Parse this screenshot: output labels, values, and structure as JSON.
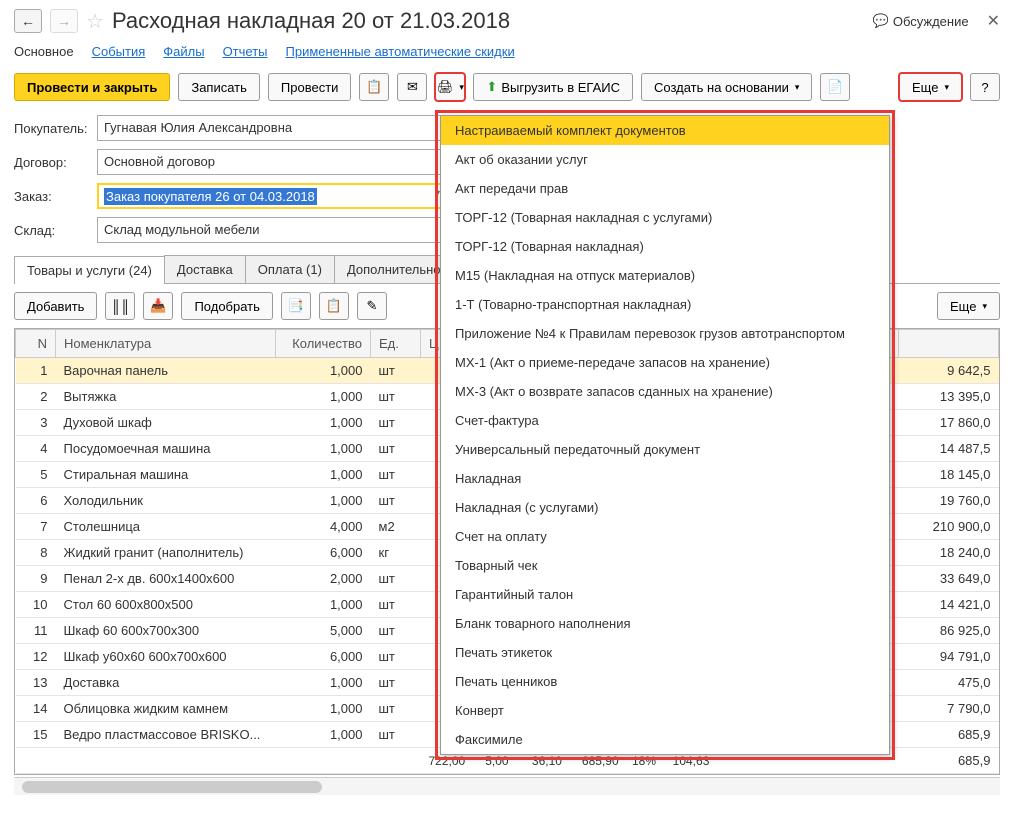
{
  "title": "Расходная накладная 20 от 21.03.2018",
  "topbar": {
    "discussion": "Обсуждение"
  },
  "navTabs": [
    "Основное",
    "События",
    "Файлы",
    "Отчеты",
    "Примененные автоматические скидки"
  ],
  "toolbar": {
    "primary": "Провести и закрыть",
    "save": "Записать",
    "post": "Провести",
    "upload": "Выгрузить в ЕГАИС",
    "createBased": "Создать на основании",
    "more": "Еще",
    "help": "?"
  },
  "form": {
    "buyerLabel": "Покупатель:",
    "buyer": "Гугнавая Юлия Александровна",
    "contractLabel": "Договор:",
    "contract": "Основной договор",
    "orderLabel": "Заказ:",
    "order": "Заказ покупателя 26 от 04.03.2018",
    "warehouseLabel": "Склад:",
    "warehouse": "Склад модульной мебели"
  },
  "subTabs": [
    "Товары и услуги (24)",
    "Доставка",
    "Оплата (1)",
    "Дополнительно"
  ],
  "tableToolbar": {
    "add": "Добавить",
    "pick": "Подобрать",
    "more": "Еще"
  },
  "columns": {
    "n": "N",
    "name": "Номенклатура",
    "qty": "Количество",
    "unit": "Ед.",
    "price": "Ц",
    "sum": ""
  },
  "rows": [
    {
      "n": 1,
      "name": "Варочная панель",
      "qty": "1,000",
      "unit": "шт",
      "sum": "9 642,5"
    },
    {
      "n": 2,
      "name": "Вытяжка",
      "qty": "1,000",
      "unit": "шт",
      "sum": "13 395,0"
    },
    {
      "n": 3,
      "name": "Духовой шкаф",
      "qty": "1,000",
      "unit": "шт",
      "sum": "17 860,0"
    },
    {
      "n": 4,
      "name": "Посудомоечная машина",
      "qty": "1,000",
      "unit": "шт",
      "sum": "14 487,5"
    },
    {
      "n": 5,
      "name": "Стиральная машина",
      "qty": "1,000",
      "unit": "шт",
      "sum": "18 145,0"
    },
    {
      "n": 6,
      "name": "Холодильник",
      "qty": "1,000",
      "unit": "шт",
      "sum": "19 760,0"
    },
    {
      "n": 7,
      "name": "Столешница",
      "qty": "4,000",
      "unit": "м2",
      "sum": "210 900,0"
    },
    {
      "n": 8,
      "name": "Жидкий гранит (наполнитель)",
      "qty": "6,000",
      "unit": "кг",
      "sum": "18 240,0"
    },
    {
      "n": 9,
      "name": "Пенал 2-х дв. 600x1400x600",
      "qty": "2,000",
      "unit": "шт",
      "sum": "33 649,0"
    },
    {
      "n": 10,
      "name": "Стол 60 600x800x500",
      "qty": "1,000",
      "unit": "шт",
      "sum": "14 421,0"
    },
    {
      "n": 11,
      "name": "Шкаф 60 600x700x300",
      "qty": "5,000",
      "unit": "шт",
      "sum": "86 925,0"
    },
    {
      "n": 12,
      "name": "Шкаф у60x60 600x700x600",
      "qty": "6,000",
      "unit": "шт",
      "sum": "94 791,0"
    },
    {
      "n": 13,
      "name": "Доставка",
      "qty": "1,000",
      "unit": "шт",
      "sum": "475,0"
    },
    {
      "n": 14,
      "name": "Облицовка жидким камнем",
      "qty": "1,000",
      "unit": "шт",
      "sum": "7 790,0"
    },
    {
      "n": 15,
      "name": "Ведро пластмассовое BRISKO...",
      "qty": "1,000",
      "unit": "шт",
      "sum": "685,9"
    }
  ],
  "footer": {
    "c1": "722,00",
    "c2": "5,00",
    "c3": "36,10",
    "c4": "685,90",
    "c5": "18%",
    "c6": "104,63"
  },
  "dropdown": [
    "Настраиваемый комплект документов",
    "Акт об оказании услуг",
    "Акт передачи прав",
    "ТОРГ-12 (Товарная накладная с услугами)",
    "ТОРГ-12 (Товарная накладная)",
    "М15 (Накладная на отпуск материалов)",
    "1-Т (Товарно-транспортная накладная)",
    "Приложение №4 к Правилам перевозок грузов автотранспортом",
    "МХ-1 (Акт о приеме-передаче запасов на хранение)",
    "МХ-3 (Акт о возврате запасов сданных на хранение)",
    "Счет-фактура",
    "Универсальный передаточный документ",
    "Накладная",
    "Накладная (с услугами)",
    "Счет на оплату",
    "Товарный чек",
    "Гарантийный талон",
    "Бланк товарного наполнения",
    "Печать этикеток",
    "Печать ценников",
    "Конверт",
    "Факсимиле"
  ]
}
